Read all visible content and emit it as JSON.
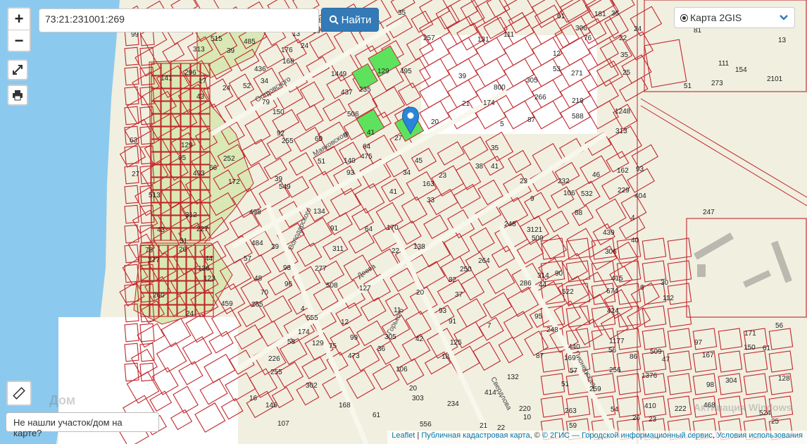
{
  "search": {
    "value": "73:21:231001:269"
  },
  "find_button": {
    "label": "Найти"
  },
  "zoom": {
    "in": "+",
    "out": "−"
  },
  "layer_select": {
    "label": "Карта 2GIS"
  },
  "not_found_button": {
    "label": "Не нашли участок/дом на карте?"
  },
  "attribution": {
    "leaflet": "Leaflet",
    "sep1": " | ",
    "cadastral": "Публичная кадастровая карта",
    "sep2": ", © ",
    "gis": "© 2ГИС — Городской информационный сервис",
    "sep3": ", ",
    "terms": "Условия использования"
  },
  "watermark_left": "Дом",
  "watermark_right": "Активация Windows",
  "streets": [
    "Островского",
    "Маяковского",
    "Володарского",
    "Деева",
    "Горького",
    "Свердлова",
    "Пионерская"
  ],
  "parcel_labels": [
    "306",
    "13",
    "27",
    "1376",
    "76",
    "9",
    "10",
    "296",
    "312",
    "313",
    "304",
    "305",
    "250",
    "248",
    "70",
    "81",
    "93",
    "61",
    "176",
    "415",
    "227",
    "168",
    "404",
    "414",
    "440",
    "475",
    "91",
    "247",
    "112",
    "674",
    "498",
    "125",
    "459",
    "154",
    "181",
    "468",
    "42",
    "30",
    "555",
    "515",
    "232",
    "493",
    "41",
    "439",
    "424",
    "222",
    "588",
    "519",
    "484",
    "485",
    "40",
    "1449",
    "35",
    "136",
    "131",
    "252",
    "138",
    "48",
    "134",
    "24",
    "266",
    "41",
    "39",
    "38",
    "123",
    "75",
    "51",
    "305",
    "306",
    "18",
    "13",
    "174",
    "56",
    "141",
    "46",
    "43",
    "7",
    "260",
    "93",
    "37",
    "16",
    "128",
    "129",
    "264",
    "277",
    "257",
    "256",
    "98",
    "61",
    "5",
    "45",
    "87",
    "25",
    "79",
    "24",
    "23",
    "52",
    "1177",
    "78",
    "22",
    "21",
    "20",
    "265",
    "273",
    "255",
    "255",
    "53",
    "54",
    "129",
    "3121",
    "82",
    "29",
    "263",
    "4",
    "138",
    "58",
    "140",
    "51",
    "26",
    "259",
    "24",
    "57",
    "36",
    "23",
    "22",
    "17",
    "27",
    "20",
    "24",
    "25",
    "35",
    "11",
    "12",
    "61",
    "271",
    "106",
    "95",
    "9",
    "132",
    "513",
    "150",
    "90",
    "302",
    "39",
    "91",
    "6",
    "170",
    "508",
    "169",
    "522",
    "174",
    "111",
    "219",
    "220",
    "127",
    "172",
    "549",
    "509",
    "167",
    "168",
    "556",
    "286",
    "524",
    "106",
    "146",
    "506",
    "532",
    "248",
    "509",
    "56",
    "473",
    "1248",
    "2101",
    "129",
    "800",
    "60",
    "64",
    "63",
    "39",
    "41",
    "43",
    "44",
    "313",
    "314",
    "303",
    "311",
    "4",
    "33",
    "12",
    "36",
    "31",
    "34",
    "35",
    "171",
    "86",
    "96",
    "99",
    "97",
    "95",
    "93",
    "92",
    "26",
    "47",
    "163",
    "162",
    "277",
    "59",
    "107",
    "21",
    "150",
    "410",
    "51",
    "34",
    "99",
    "39",
    "226",
    "234",
    "235",
    "229",
    "111",
    "44",
    "88",
    "87",
    "20",
    "23",
    "436",
    "495",
    "437",
    "98",
    "57",
    "66",
    "64",
    "22"
  ],
  "colors": {
    "parcel_stroke": "#c0272d",
    "background": "#f1efe0",
    "water": "#8cc9ee",
    "garden": "#d9e8b4",
    "selected": "#5ee25e",
    "button": "#337ab7",
    "marker": "#2a85d8"
  }
}
